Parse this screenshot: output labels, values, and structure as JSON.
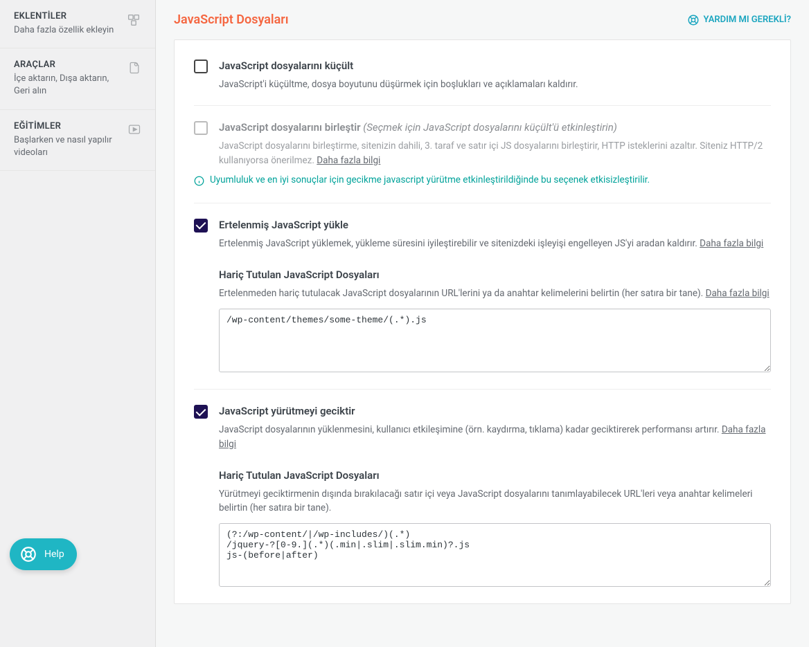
{
  "sidebar": {
    "items": [
      {
        "title": "EKLENTİLER",
        "subtitle": "Daha fazla özellik ekleyin",
        "icon": "blocks"
      },
      {
        "title": "ARAÇLAR",
        "subtitle": "İçe aktarın, Dışa aktarın, Geri alın",
        "icon": "page"
      },
      {
        "title": "EĞİTİMLER",
        "subtitle": "Başlarken ve nasıl yapılır videoları",
        "icon": "play"
      }
    ]
  },
  "header": {
    "title": "JavaScript Dosyaları",
    "help_label": "YARDIM MI GEREKLİ?"
  },
  "options": {
    "minify": {
      "title": "JavaScript dosyalarını küçült",
      "desc": "JavaScript'i küçültme, dosya boyutunu düşürmek için boşlukları ve açıklamaları kaldırır."
    },
    "combine": {
      "title": "JavaScript dosyalarını birleştir",
      "hint": "(Seçmek için JavaScript dosyalarını küçült'ü etkinleştirin)",
      "desc": "JavaScript dosyalarını birleştirme, sitenizin dahili, 3. taraf ve satır içi JS dosyalarını birleştirir, HTTP isteklerini azaltır. Siteniz HTTP/2 kullanıyorsa önerilmez.",
      "more": "Daha fazla bilgi",
      "notice": "Uyumluluk ve en iyi sonuçlar için gecikme javascript yürütme etkinleştirildiğinde bu seçenek etkisizleştirilir."
    },
    "defer": {
      "title": "Ertelenmiş JavaScript yükle",
      "desc": "Ertelenmiş JavaScript yüklemek, yükleme süresini iyileştirebilir ve sitenizdeki işleyişi engelleyen JS'yi aradan kaldırır.",
      "more": "Daha fazla bilgi",
      "exclude_title": "Hariç Tutulan JavaScript Dosyaları",
      "exclude_desc": "Ertelenmeden hariç tutulacak JavaScript dosyalarının URL'lerini ya da anahtar kelimelerini belirtin (her satıra bir tane).",
      "exclude_more": "Daha fazla bilgi",
      "exclude_value": "/wp-content/themes/some-theme/(.*).js"
    },
    "delay": {
      "title": "JavaScript yürütmeyi geciktir",
      "desc": "JavaScript dosyalarının yüklenmesini, kullanıcı etkileşimine (örn. kaydırma, tıklama) kadar geciktirerek performansı artırır.",
      "more": "Daha fazla bilgi",
      "exclude_title": "Hariç Tutulan JavaScript Dosyaları",
      "exclude_desc": "Yürütmeyi geciktirmenin dışında bırakılacağı satır içi veya JavaScript dosyalarını tanımlayabilecek URL'leri veya anahtar kelimeleri belirtin (her satıra bir tane).",
      "exclude_value": "(?:/wp-content/|/wp-includes/)(.*)\n/jquery-?[0-9.](.*)(.min|.slim|.slim.min)?.js\njs-(before|after)"
    }
  },
  "help_float": {
    "label": "Help"
  }
}
